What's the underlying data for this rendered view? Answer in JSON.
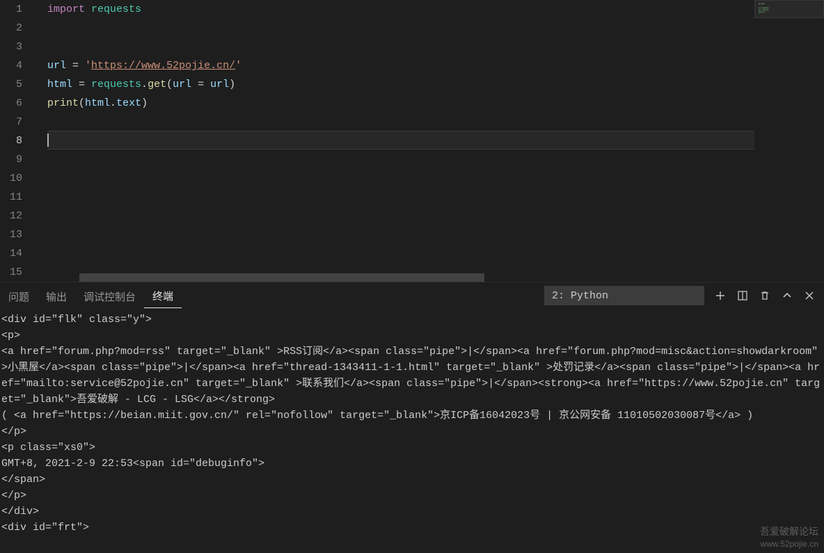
{
  "editor": {
    "lineNumbers": [
      "1",
      "2",
      "3",
      "4",
      "5",
      "6",
      "7",
      "8",
      "9",
      "10",
      "11",
      "12",
      "13",
      "14",
      "15"
    ],
    "activeLine": 8,
    "code": {
      "l1": {
        "kw": "import",
        "mod": "requests"
      },
      "l4": {
        "var": "url",
        "eq": " = ",
        "q1": "'",
        "url": "https://www.52pojie.cn/",
        "q2": "'"
      },
      "l5": {
        "var1": "html",
        "eq": " = ",
        "mod": "requests",
        "dot": ".",
        "fn": "get",
        "op": "(",
        "arg": "url",
        "eq2": " = ",
        "arg2": "url",
        "cp": ")"
      },
      "l6": {
        "fn": "print",
        "op": "(",
        "v1": "html",
        "dot": ".",
        "v2": "text",
        "cp": ")"
      }
    }
  },
  "panel": {
    "tabs": {
      "problems": "问题",
      "output": "输出",
      "debug": "调试控制台",
      "terminal": "终端"
    },
    "activeTab": "terminal",
    "terminalSelector": "2: Python",
    "icons": {
      "add": "add-icon",
      "split": "split-icon",
      "kill": "trash-icon",
      "maximize": "chevron-up-icon",
      "close": "close-icon"
    }
  },
  "terminal": {
    "content": "<div id=\"flk\" class=\"y\">\n<p>\n<a href=\"forum.php?mod=rss\" target=\"_blank\" >RSS订阅</a><span class=\"pipe\">|</span><a href=\"forum.php?mod=misc&action=showdarkroom\" >小黑屋</a><span class=\"pipe\">|</span><a href=\"thread-1343411-1-1.html\" target=\"_blank\" >处罚记录</a><span class=\"pipe\">|</span><a href=\"mailto:service@52pojie.cn\" target=\"_blank\" >联系我们</a><span class=\"pipe\">|</span><strong><a href=\"https://www.52pojie.cn\" target=\"_blank\">吾爱破解 - LCG - LSG</a></strong>\n( <a href=\"https://beian.miit.gov.cn/\" rel=\"nofollow\" target=\"_blank\">京ICP备16042023号 | 京公网安备 11010502030087号</a> )\n</p>\n<p class=\"xs0\">\nGMT+8, 2021-2-9 22:53<span id=\"debuginfo\">\n</span>\n</p>\n</div>\n<div id=\"frt\">"
  },
  "watermark": {
    "line1": "吾爱破解论坛",
    "line2": "www.52pojie.cn"
  }
}
